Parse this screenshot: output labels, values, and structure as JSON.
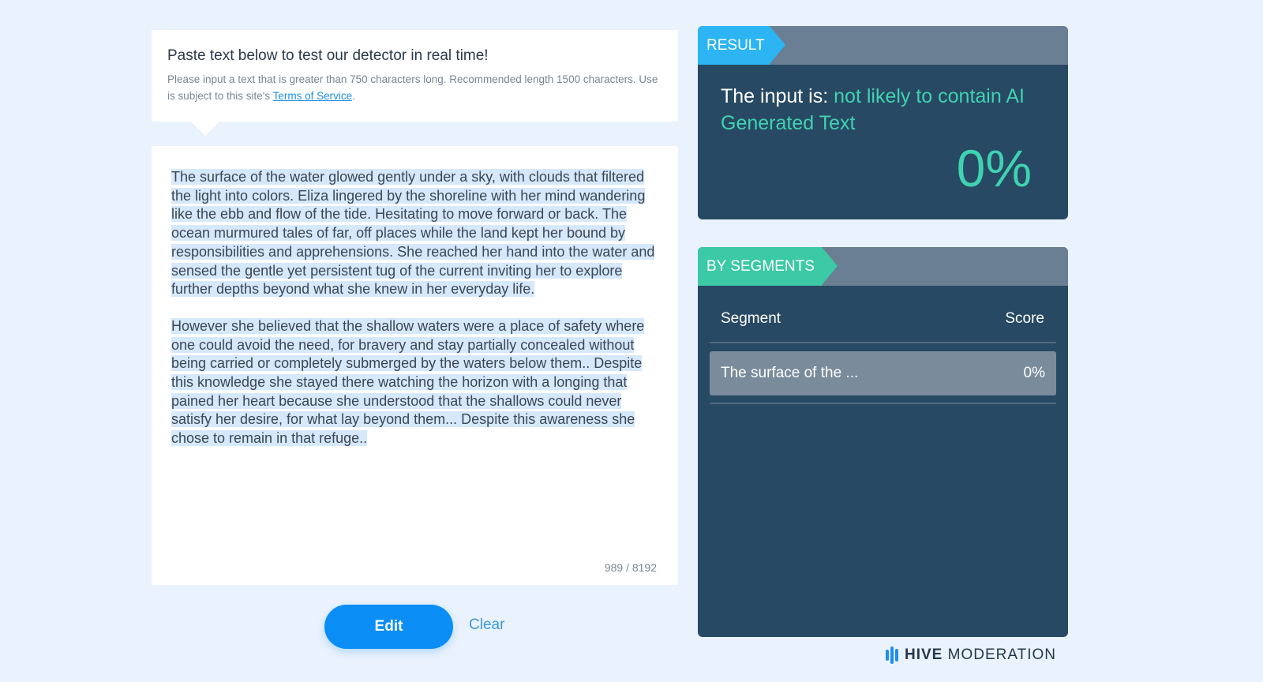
{
  "instructions": {
    "title": "Paste text below to test our detector in real time!",
    "desc": "Please input a text that is greater than 750 characters long. Recommended length 1500 characters. Use is subject to this site's",
    "link": "Terms of Service",
    "period": "."
  },
  "input": {
    "paragraph1": "The surface of the water glowed gently under a sky, with clouds that filtered the light into colors. Eliza lingered by the shoreline with her mind wandering like the ebb and flow of the tide. Hesitating to move forward or back. The ocean murmured tales of far, off places while the land kept her bound by responsibilities and apprehensions. She reached her hand into the water and sensed the gentle yet persistent tug of the current inviting her to explore further depths beyond what she knew in her everyday life.",
    "paragraph2": "However she believed that the shallow waters were a place of safety where one could avoid the need, for bravery and stay partially concealed without being carried or completely submerged by the waters below them.. Despite this knowledge she stayed there watching the horizon with a longing that pained her heart because she understood that the shallows could never satisfy her desire, for what lay beyond them... Despite this awareness she chose to remain in that refuge..",
    "char_count": "989 / 8192"
  },
  "actions": {
    "edit_label": "Edit",
    "clear_label": "Clear"
  },
  "result": {
    "tag": "RESULT",
    "prefix": "The input is: ",
    "verdict": "not likely to contain AI Generated Text",
    "score": "0%"
  },
  "segments": {
    "tag": "BY SEGMENTS",
    "col_segment": "Segment",
    "col_score": "Score",
    "rows": [
      {
        "text": "The surface of the ...",
        "score": "0%"
      }
    ]
  },
  "brand": {
    "bold": "HIVE",
    "rest": "MODERATION"
  },
  "colors": {
    "accent": "#0a8ef5",
    "panel": "#284963",
    "highlight": "#3fd2b1",
    "result_tag": "#2cb5f2",
    "segments_tag": "#3cc9a5"
  }
}
